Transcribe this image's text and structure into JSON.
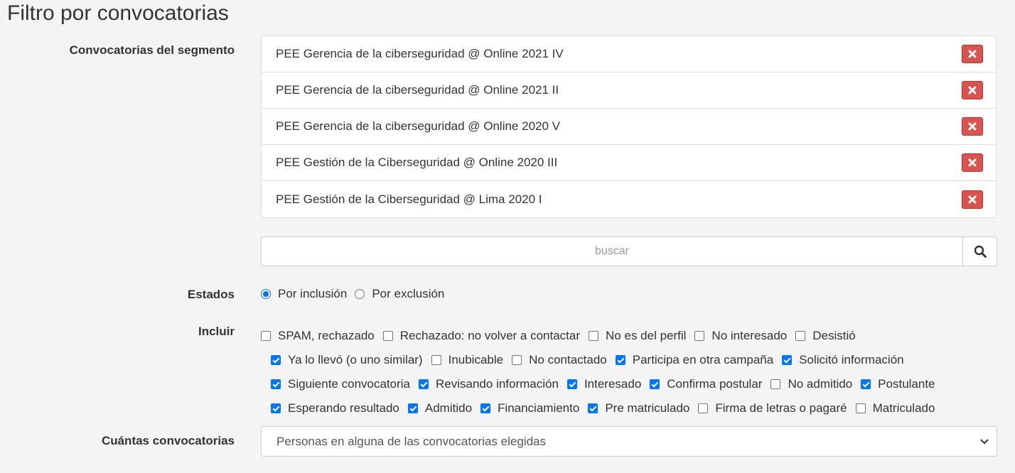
{
  "page_title": "Filtro por convocatorias",
  "labels": {
    "convocatorias": "Convocatorias del segmento",
    "estados": "Estados",
    "incluir": "Incluir",
    "cuantas": "Cuántas convocatorias"
  },
  "convocatorias": [
    "PEE Gerencia de la ciberseguridad @ Online 2021 IV",
    "PEE Gerencia de la ciberseguridad @ Online 2021 II",
    "PEE Gerencia de la ciberseguridad @ Online 2020 V",
    "PEE Gestión de la Ciberseguridad @ Online 2020 III",
    "PEE Gestión de la Ciberseguridad @ Lima 2020 I"
  ],
  "search": {
    "placeholder": "buscar",
    "value": ""
  },
  "estados": [
    {
      "label": "Por inclusión",
      "checked": true
    },
    {
      "label": "Por exclusión",
      "checked": false
    }
  ],
  "incluir_rows": [
    [
      {
        "label": "SPAM, rechazado",
        "checked": false
      },
      {
        "label": "Rechazado: no volver a contactar",
        "checked": false
      },
      {
        "label": "No es del perfil",
        "checked": false
      },
      {
        "label": "No interesado",
        "checked": false
      },
      {
        "label": "Desistió",
        "checked": false
      }
    ],
    [
      {
        "label": "Ya lo llevó (o uno similar)",
        "checked": true
      },
      {
        "label": "Inubicable",
        "checked": false
      },
      {
        "label": "No contactado",
        "checked": false
      },
      {
        "label": "Participa en otra campaña",
        "checked": true
      },
      {
        "label": "Solicitó información",
        "checked": true
      }
    ],
    [
      {
        "label": "Siguiente convocatoria",
        "checked": true
      },
      {
        "label": "Revisando información",
        "checked": true
      },
      {
        "label": "Interesado",
        "checked": true
      },
      {
        "label": "Confirma postular",
        "checked": true
      },
      {
        "label": "No admitido",
        "checked": false
      },
      {
        "label": "Postulante",
        "checked": true
      }
    ],
    [
      {
        "label": "Esperando resultado",
        "checked": true
      },
      {
        "label": "Admitido",
        "checked": true
      },
      {
        "label": "Financiamiento",
        "checked": true
      },
      {
        "label": "Pre matriculado",
        "checked": true
      },
      {
        "label": "Firma de letras o pagaré",
        "checked": false
      },
      {
        "label": "Matriculado",
        "checked": false
      }
    ]
  ],
  "cuantas_select": {
    "value": "Personas en alguna de las convocatorias elegidas"
  },
  "icons": {
    "delete": "times-icon",
    "search": "search-icon",
    "select": "chevron-down-icon"
  },
  "colors": {
    "delete_bg": "#d9534f",
    "accent": "#0075ff"
  }
}
